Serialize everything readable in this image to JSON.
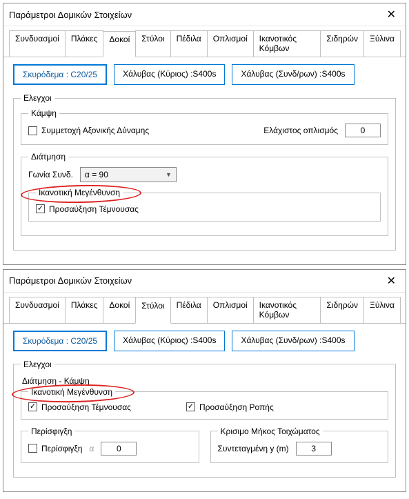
{
  "dialogs": [
    {
      "title": "Παράμετροι Δομικών Στοιχείων",
      "tabs": [
        "Συνδυασμοί",
        "Πλάκες",
        "Δοκοί",
        "Στύλοι",
        "Πέδιλα",
        "Οπλισμοί",
        "Ικανοτικός Κόμβων",
        "Σιδηρών",
        "Ξύλινα"
      ],
      "active_tab": "Δοκοί",
      "buttons": {
        "concrete": "Σκυρόδεμα : C20/25",
        "steel_main": "Χάλυβας (Κύριος) :S400s",
        "steel_sec": "Χάλυβας (Συνδ/ρων) :S400s"
      },
      "checks_legend": "Ελεγχοι",
      "bending": {
        "legend": "Κάμψη",
        "axial_label": "Συμμετοχή Αξονικής Δύναμης",
        "axial_checked": false,
        "minreinf_label": "Ελάχιστος οπλισμός",
        "minreinf_value": "0"
      },
      "shear": {
        "legend": "Διάτμηση",
        "angle_label": "Γωνία Συνδ.",
        "angle_value": "α = 90",
        "capacity_legend": "Ικανοτική Μεγένθυνση",
        "shear_increase_label": "Προσαύξηση Τέμνουσας",
        "shear_increase_checked": true
      }
    },
    {
      "title": "Παράμετροι Δομικών Στοιχείων",
      "tabs": [
        "Συνδυασμοί",
        "Πλάκες",
        "Δοκοί",
        "Στύλοι",
        "Πέδιλα",
        "Οπλισμοί",
        "Ικανοτικός Κόμβων",
        "Σιδηρών",
        "Ξύλινα"
      ],
      "active_tab": "Στύλοι",
      "buttons": {
        "concrete": "Σκυρόδεμα : C20/25",
        "steel_main": "Χάλυβας (Κύριος) :S400s",
        "steel_sec": "Χάλυβας (Συνδ/ρων) :S400s"
      },
      "checks_legend": "Ελεγχοι",
      "line1": "Διάτμηση - Κάμψη",
      "capacity_legend": "Ικανοτική Μεγένθυνση",
      "shear_increase_label": "Προσαύξηση Τέμνουσας",
      "shear_increase_checked": true,
      "moment_increase_label": "Προσαύξηση Ροπής",
      "moment_increase_checked": true,
      "confinement": {
        "legend": "Περίσφιγξη",
        "label": "Περίσφιγξη",
        "checked": false,
        "alpha_label": "α",
        "value": "0"
      },
      "wall": {
        "legend": "Κρισιμο Μήκος Τοιχώματος",
        "label": "Συντεταγμένη y (m)",
        "value": "3"
      }
    }
  ]
}
